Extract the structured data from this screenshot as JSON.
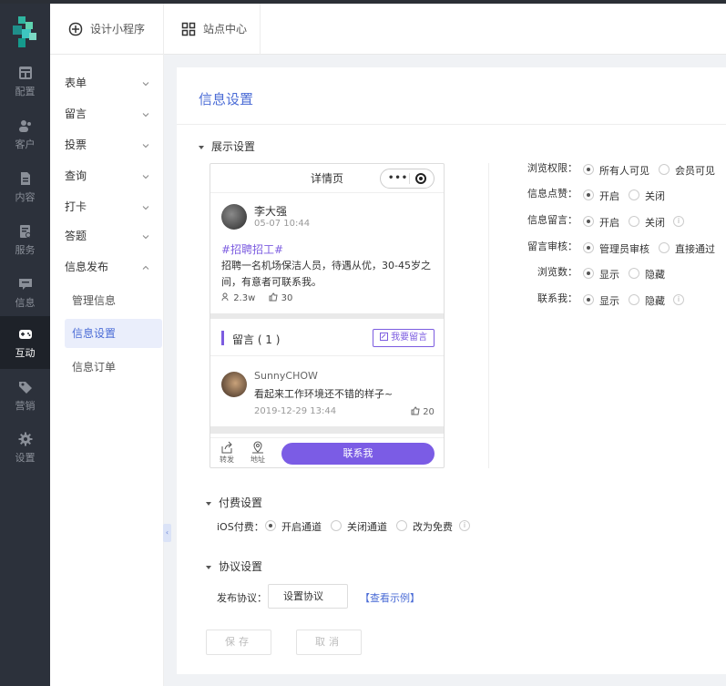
{
  "rail": {
    "items": [
      {
        "label": "配置",
        "icon": "dashboard-icon"
      },
      {
        "label": "客户",
        "icon": "users-icon"
      },
      {
        "label": "内容",
        "icon": "document-icon"
      },
      {
        "label": "服务",
        "icon": "service-icon"
      },
      {
        "label": "信息",
        "icon": "message-icon"
      },
      {
        "label": "互动",
        "icon": "gamepad-icon"
      },
      {
        "label": "营销",
        "icon": "tag-icon"
      },
      {
        "label": "设置",
        "icon": "gear-icon"
      }
    ],
    "active_index": 5
  },
  "topbar": {
    "tabs": [
      {
        "label": "设计小程序",
        "icon": "design-icon"
      },
      {
        "label": "站点中心",
        "icon": "grid-icon"
      }
    ]
  },
  "subnav": {
    "items": [
      "表单",
      "留言",
      "投票",
      "查询",
      "打卡",
      "答题",
      "信息发布"
    ],
    "sub_items": [
      "管理信息",
      "信息设置",
      "信息订单"
    ],
    "active_sub": "信息设置"
  },
  "panel": {
    "title": "信息设置",
    "display_section": "展示设置",
    "paid_section": "付费设置",
    "agreement_section": "协议设置"
  },
  "phone": {
    "header_title": "详情页",
    "capsule_dots": "•••",
    "author": "李大强",
    "post_time": "05-07 10:44",
    "tag": "#招聘招工#",
    "content": "招聘一名机场保洁人员，待遇从优，30-45岁之间，有意者可联系我。",
    "views": "2.3w",
    "likes": "30",
    "comment_header": "留言 ( 1 )",
    "comment_button": "我要留言",
    "commenter": "SunnyCHOW",
    "comment_text": "看起来工作环境还不错的样子~",
    "comment_time": "2019-12-29 13:44",
    "comment_likes": "20",
    "share_label": "转发",
    "address_label": "地址",
    "contact_button": "联系我"
  },
  "settings": [
    {
      "label": "浏览权限：",
      "options": [
        "所有人可见",
        "会员可见"
      ],
      "selected": 0,
      "info": false
    },
    {
      "label": "信息点赞：",
      "options": [
        "开启",
        "关闭"
      ],
      "selected": 0,
      "info": false
    },
    {
      "label": "信息留言：",
      "options": [
        "开启",
        "关闭"
      ],
      "selected": 0,
      "info": true
    },
    {
      "label": "留言审核：",
      "options": [
        "管理员审核",
        "直接通过"
      ],
      "selected": 0,
      "info": false
    },
    {
      "label": "浏览数：",
      "options": [
        "显示",
        "隐藏"
      ],
      "selected": 0,
      "info": false
    },
    {
      "label": "联系我：",
      "options": [
        "显示",
        "隐藏"
      ],
      "selected": 0,
      "info": true
    }
  ],
  "ios_payment": {
    "label": "iOS付费：",
    "options": [
      "开启通道",
      "关闭通道",
      "改为免费"
    ],
    "selected": 0
  },
  "agreement": {
    "label": "发布协议：",
    "button": "设置协议",
    "link": "【查看示例】"
  },
  "actions": {
    "save": "保存",
    "cancel": "取消"
  },
  "colors": {
    "accent": "#4b6cd6",
    "purple": "#7b5ce5",
    "rail_bg": "#2c313b"
  }
}
